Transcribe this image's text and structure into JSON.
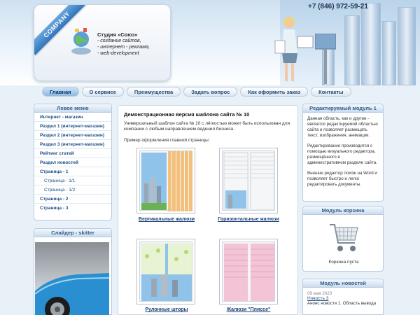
{
  "header": {
    "ribbon": "COMPANY",
    "studio_name": "Студия «Союз»",
    "studio_lines": [
      "- создание сайтов,",
      "- интернет - реклама,",
      "- web-development"
    ],
    "phone": "+7 (846) 972-59-21"
  },
  "nav": {
    "tabs": [
      "Главная",
      "О сервисе",
      "Преимущества",
      "Задать вопрос",
      "Как оформить заказ",
      "Контакты"
    ]
  },
  "left_menu": {
    "title": "Левое меню",
    "items": [
      {
        "label": "Интернет - магазин",
        "sub": false
      },
      {
        "label": "Раздел 1 (интернет-магазин)",
        "sub": false
      },
      {
        "label": "Раздел 2 (интернет-магазин)",
        "sub": false
      },
      {
        "label": "Раздел 3 (интернет-магазин)",
        "sub": false
      },
      {
        "label": "Рейтинг статей",
        "sub": false
      },
      {
        "label": "Раздел новостей",
        "sub": false
      },
      {
        "label": "Страница - 1",
        "sub": false
      },
      {
        "label": "Страница - 1/1",
        "sub": true
      },
      {
        "label": "Страница - 1/2",
        "sub": true
      },
      {
        "label": "Страница - 2",
        "sub": false
      },
      {
        "label": "Страница - 3",
        "sub": false
      }
    ]
  },
  "slider": {
    "title": "Слайдер - skitter"
  },
  "main": {
    "title": "Демонстрационная версия шаблона сайта № 10",
    "paragraph": "Универсальный шаблон сайта № 10 с лёгкостью может быть использован для компании с любым направлением ведения бизнеса.",
    "caption": "Пример оформления главной страницы:",
    "products": [
      {
        "label": "Вертикальные жалюзи"
      },
      {
        "label": "Горизонтальные жалюзи"
      },
      {
        "label": "Рулонные шторы"
      },
      {
        "label": "Жалюзи \"Плиссе\""
      }
    ]
  },
  "right": {
    "module1": {
      "title": "Редактируемый модуль 1",
      "p1": "Данная область, как и другие - является редактируемой областью сайта и позволяет размещать текст, изображения, анимации.",
      "p2": "Редактирование производится с помощью визуального редактора, размещённого в административном разделе сайта.",
      "p3": "Внешне редактор похож на Word и позволяет быстро и легко редактировать документы."
    },
    "cart": {
      "title": "Модуль корзина",
      "status": "Корзина пуста"
    },
    "news": {
      "title": "Модуль новостей",
      "date": "09 мая 2020",
      "link": "Новость 3",
      "body": "Анонс новости 1. Область вывода"
    }
  },
  "colors": {
    "accent": "#1b4f86",
    "ribbon": "#2f75bd",
    "panel_head": "#cbdcee"
  }
}
